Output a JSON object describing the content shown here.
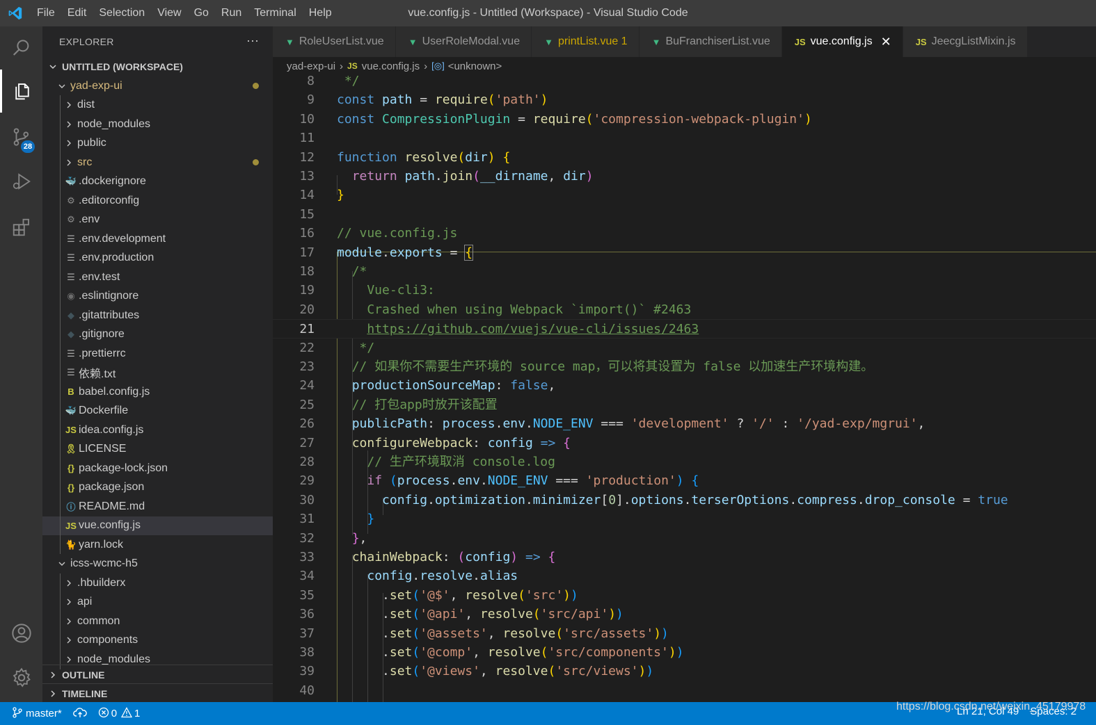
{
  "window": {
    "title": "vue.config.js - Untitled (Workspace) - Visual Studio Code",
    "menu": [
      "File",
      "Edit",
      "Selection",
      "View",
      "Go",
      "Run",
      "Terminal",
      "Help"
    ]
  },
  "activity_bar": {
    "items": [
      "search-icon",
      "explorer-icon",
      "source-control-icon",
      "run-debug-icon",
      "extensions-icon"
    ],
    "source_control_badge": "28",
    "bottom": [
      "accounts-icon",
      "settings-gear-icon"
    ]
  },
  "sidebar": {
    "header": "EXPLORER",
    "more": "···",
    "workspace": "UNTITLED (WORKSPACE)",
    "tree": [
      {
        "label": "yad-exp-ui",
        "kind": "folder-open",
        "modified": true
      },
      {
        "label": "dist",
        "kind": "folder"
      },
      {
        "label": "node_modules",
        "kind": "folder"
      },
      {
        "label": "public",
        "kind": "folder"
      },
      {
        "label": "src",
        "kind": "folder",
        "modified": true
      },
      {
        "label": ".dockerignore",
        "kind": "docker"
      },
      {
        "label": ".editorconfig",
        "kind": "gear"
      },
      {
        "label": ".env",
        "kind": "gear"
      },
      {
        "label": ".env.development",
        "kind": "lines"
      },
      {
        "label": ".env.production",
        "kind": "lines"
      },
      {
        "label": ".env.test",
        "kind": "lines"
      },
      {
        "label": ".eslintignore",
        "kind": "circle"
      },
      {
        "label": ".gitattributes",
        "kind": "git"
      },
      {
        "label": ".gitignore",
        "kind": "git"
      },
      {
        "label": ".prettierrc",
        "kind": "lines"
      },
      {
        "label": "依赖.txt",
        "kind": "lines"
      },
      {
        "label": "babel.config.js",
        "kind": "babel"
      },
      {
        "label": "Dockerfile",
        "kind": "docker"
      },
      {
        "label": "idea.config.js",
        "kind": "js"
      },
      {
        "label": "LICENSE",
        "kind": "license"
      },
      {
        "label": "package-lock.json",
        "kind": "json"
      },
      {
        "label": "package.json",
        "kind": "json"
      },
      {
        "label": "README.md",
        "kind": "info"
      },
      {
        "label": "vue.config.js",
        "kind": "js",
        "selected": true
      },
      {
        "label": "yarn.lock",
        "kind": "yarn"
      },
      {
        "label": "icss-wcmc-h5",
        "kind": "folder-open"
      },
      {
        "label": ".hbuilderx",
        "kind": "folder"
      },
      {
        "label": "api",
        "kind": "folder"
      },
      {
        "label": "common",
        "kind": "folder"
      },
      {
        "label": "components",
        "kind": "folder"
      },
      {
        "label": "node_modules",
        "kind": "folder"
      }
    ],
    "outline": "OUTLINE",
    "timeline": "TIMELINE"
  },
  "tabs": [
    {
      "label": "RoleUserList.vue",
      "icon": "vue"
    },
    {
      "label": "UserRoleModal.vue",
      "icon": "vue"
    },
    {
      "label": "printList.vue 1",
      "icon": "vue",
      "modified": true
    },
    {
      "label": "BuFranchiserList.vue",
      "icon": "vue"
    },
    {
      "label": "vue.config.js",
      "icon": "js",
      "active": true,
      "close": "✕"
    },
    {
      "label": "JeecgListMixin.js",
      "icon": "js"
    }
  ],
  "breadcrumb": {
    "folder": "yad-exp-ui",
    "file": "vue.config.js",
    "symbol": "<unknown>"
  },
  "editor": {
    "current_line": 21,
    "lines": [
      {
        "n": 8
      },
      {
        "n": 9
      },
      {
        "n": 10
      },
      {
        "n": 11
      },
      {
        "n": 12
      },
      {
        "n": 13
      },
      {
        "n": 14
      },
      {
        "n": 15
      },
      {
        "n": 16
      },
      {
        "n": 17
      },
      {
        "n": 18
      },
      {
        "n": 19
      },
      {
        "n": 20
      },
      {
        "n": 21
      },
      {
        "n": 22
      },
      {
        "n": 23
      },
      {
        "n": 24
      },
      {
        "n": 25
      },
      {
        "n": 26
      },
      {
        "n": 27
      },
      {
        "n": 28
      },
      {
        "n": 29
      },
      {
        "n": 30
      },
      {
        "n": 31
      },
      {
        "n": 32
      },
      {
        "n": 33
      },
      {
        "n": 34
      },
      {
        "n": 35
      },
      {
        "n": 36
      },
      {
        "n": 37
      },
      {
        "n": 38
      },
      {
        "n": 39
      },
      {
        "n": 40
      }
    ]
  },
  "statusbar": {
    "branch": "master*",
    "errors": "0",
    "warnings": "1",
    "position": "Ln 21, Col 49",
    "spaces": "Spaces: 2",
    "watermark": "https://blog.csdn.net/weixin_45179978"
  },
  "colors": {
    "accent": "#007acc",
    "editor_bg": "#1e1e1e",
    "sidebar_bg": "#252526",
    "activity_bg": "#333333",
    "vue_icon": "#41b883",
    "js_icon": "#cbcb41"
  }
}
